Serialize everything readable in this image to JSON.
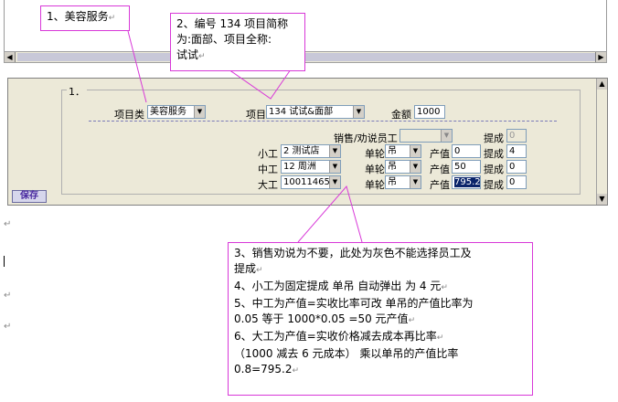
{
  "callouts": {
    "c1": "1、美容服务",
    "c2_lines": [
      "2、编号 134 项目简称",
      "为:面部、项目全称:",
      "试试"
    ],
    "c3_lines": [
      "3、销售劝说为不要，此处为灰色不能选择员工及",
      "提成",
      "4、小工为固定提成  单吊  自动弹出  为 4 元",
      "5、中工为产值=实收比率可改  单吊的产值比率为",
      "0.05    等于 1000*0.05 =50 元产值",
      "6、大工为产值=实收价格减去成本再比率",
      "（1000  减去  6  元成本）   乘以单吊的产值比率",
      "0.8=795.2"
    ],
    "para_mark": "↵"
  },
  "form": {
    "group_title": "1．",
    "item_category_label": "项目类",
    "item_category_value": "美容服务",
    "item_label": "项目",
    "item_value": "134 试试&面部",
    "amount_label": "金额",
    "amount_value": "1000",
    "sales_label": "销售/劝说员工",
    "sales_commission_label": "提成",
    "sales_commission_value": "0",
    "rows": [
      {
        "role": "小工",
        "staff": "2   测试店",
        "type_label": "单轮",
        "type": "吊",
        "value_label": "产值",
        "value": "0",
        "commission_label": "提成",
        "commission": "4"
      },
      {
        "role": "中工",
        "staff": "12  周洲",
        "type_label": "单轮",
        "type": "吊",
        "value_label": "产值",
        "value": "50",
        "commission_label": "提成",
        "commission": "0"
      },
      {
        "role": "大工",
        "staff": "100114654",
        "type_label": "单轮",
        "type": "吊",
        "value_label": "产值",
        "value": "795.2",
        "commission_label": "提成",
        "commission": "0"
      }
    ],
    "save_label": "保存"
  },
  "colors": {
    "callout_border": "#d838d8",
    "selection": "#0a246a"
  },
  "icons": {
    "dropdown": "chevron-down-icon",
    "scroll_left": "arrow-left-icon",
    "scroll_right": "arrow-right-icon",
    "scroll_up": "arrow-up-icon",
    "scroll_down": "arrow-down-icon"
  }
}
